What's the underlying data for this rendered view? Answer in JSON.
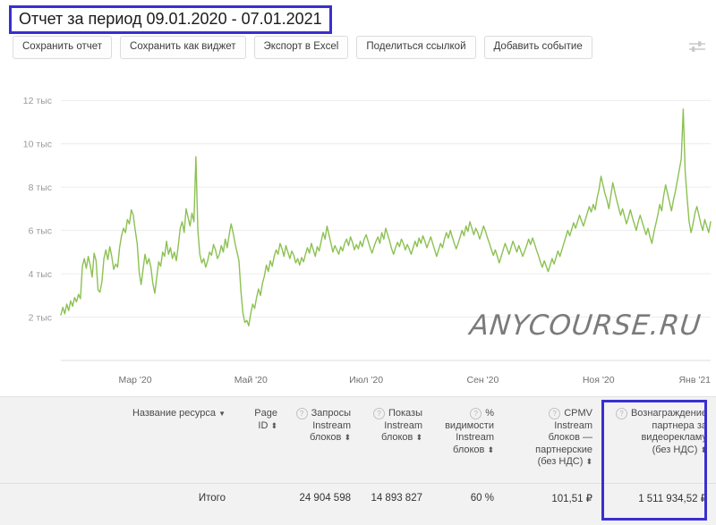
{
  "header": {
    "title": "Отчет за период 09.01.2020 - 07.01.2021",
    "highlight_color": "#3a2fd0"
  },
  "toolbar": {
    "buttons": [
      {
        "label": "Сохранить отчет",
        "name": "save-report-button"
      },
      {
        "label": "Сохранить как виджет",
        "name": "save-as-widget-button"
      },
      {
        "label": "Экспорт в Excel",
        "name": "export-excel-button"
      },
      {
        "label": "Поделиться ссылкой",
        "name": "share-link-button"
      },
      {
        "label": "Добавить событие",
        "name": "add-event-button"
      }
    ],
    "settings_icon": "sliders-icon"
  },
  "watermark": "ANYCOURSE.RU",
  "chart_data": {
    "type": "line",
    "title": "",
    "xlabel": "",
    "ylabel": "",
    "line_color": "#8cc152",
    "grid": true,
    "ylim": [
      0,
      13000
    ],
    "yticks": [
      2000,
      4000,
      6000,
      8000,
      10000,
      12000
    ],
    "ytick_labels": [
      "2 тыс",
      "4 тыс",
      "6 тыс",
      "8 тыс",
      "10 тыс",
      "12 тыс"
    ],
    "xtick_labels": [
      "Мар '20",
      "Май '20",
      "Июл '20",
      "Сен '20",
      "Ноя '20",
      "Янв '21"
    ],
    "xtick_positions": [
      0.14,
      0.318,
      0.496,
      0.674,
      0.852,
      1.0
    ],
    "series": [
      {
        "name": "Вознаграждение партнера за видеорекламу",
        "values": [
          2100,
          2450,
          2150,
          2600,
          2300,
          2750,
          2500,
          2900,
          2700,
          3050,
          2850,
          4350,
          4700,
          4250,
          4800,
          4400,
          3850,
          4950,
          4600,
          3250,
          3150,
          3650,
          4700,
          5100,
          4650,
          5250,
          4800,
          4200,
          4450,
          4300,
          5200,
          5750,
          6100,
          5900,
          6500,
          6300,
          6950,
          6700,
          6000,
          5400,
          4100,
          3500,
          4200,
          4900,
          4450,
          4700,
          4300,
          3550,
          3100,
          3850,
          4550,
          4350,
          5000,
          4800,
          5500,
          4900,
          5200,
          4700,
          5000,
          4600,
          5300,
          6100,
          6400,
          5900,
          7000,
          6600,
          6200,
          6800,
          6400,
          9400,
          6000,
          4900,
          4500,
          4700,
          4300,
          4600,
          5000,
          4850,
          5350,
          5100,
          4700,
          4900,
          5300,
          5000,
          5600,
          5200,
          5800,
          6300,
          5900,
          5400,
          5000,
          4600,
          3200,
          2200,
          1750,
          1850,
          1600,
          2150,
          2600,
          2400,
          2900,
          3300,
          3000,
          3550,
          3900,
          4400,
          4100,
          4600,
          4350,
          4800,
          5100,
          4900,
          5400,
          5150,
          4800,
          5300,
          5000,
          4700,
          5050,
          4850,
          4500,
          4700,
          4400,
          4750,
          4550,
          4900,
          5200,
          4950,
          5400,
          5100,
          4800,
          5250,
          5050,
          5500,
          5900,
          5600,
          6200,
          5800,
          5400,
          5000,
          5300,
          5100,
          4900,
          5250,
          5050,
          5400,
          5600,
          5300,
          5700,
          5450,
          5100,
          5350,
          5150,
          5500,
          5250,
          5600,
          5800,
          5500,
          5200,
          4950,
          5250,
          5500,
          5700,
          5400,
          5900,
          5600,
          6100,
          5800,
          5500,
          5150,
          4900,
          5200,
          5450,
          5250,
          5600,
          5400,
          5100,
          5350,
          5150,
          4900,
          5200,
          5500,
          5250,
          5650,
          5400,
          5750,
          5500,
          5200,
          5450,
          5700,
          5400,
          5100,
          4800,
          5100,
          5400,
          5200,
          5600,
          5900,
          5650,
          6000,
          5700,
          5400,
          5150,
          5400,
          5700,
          6000,
          5750,
          6200,
          5950,
          6400,
          6100,
          5800,
          6100,
          5900,
          5600,
          5900,
          6200,
          5950,
          5650,
          5400,
          5100,
          4850,
          5100,
          4800,
          4500,
          4800,
          5100,
          5400,
          5150,
          4900,
          5200,
          5500,
          5250,
          5000,
          5300,
          5050,
          4800,
          5050,
          5300,
          5600,
          5350,
          5650,
          5400,
          5100,
          4850,
          4550,
          4300,
          4600,
          4350,
          4100,
          4400,
          4700,
          4450,
          4750,
          5050,
          4800,
          5100,
          5400,
          5700,
          6000,
          5750,
          6050,
          6350,
          6100,
          6400,
          6700,
          6450,
          6200,
          6500,
          6800,
          7100,
          6850,
          7200,
          6950,
          7500,
          7900,
          8500,
          8100,
          7700,
          7400,
          7000,
          7600,
          8200,
          7800,
          7400,
          7050,
          6700,
          7000,
          6650,
          6300,
          6600,
          6950,
          6600,
          6300,
          6000,
          6400,
          6700,
          6400,
          6100,
          5800,
          6100,
          5700,
          5400,
          5900,
          6300,
          6700,
          7200,
          6900,
          7600,
          8100,
          7700,
          7300,
          6900,
          7400,
          7800,
          8300,
          8800,
          9300,
          11600,
          8700,
          7500,
          6400,
          5900,
          6300,
          6800,
          7100,
          6700,
          6300,
          6000,
          6500,
          6200,
          5900,
          6400
        ]
      }
    ]
  },
  "table": {
    "columns": [
      {
        "name": "resource-name",
        "lines": [
          "Название ресурса"
        ],
        "sort": "caret",
        "help": false
      },
      {
        "name": "page-id",
        "lines": [
          "Page",
          "ID"
        ],
        "sort": "updown",
        "help": false
      },
      {
        "name": "instream-requests",
        "lines": [
          "Запросы",
          "Instream",
          "блоков"
        ],
        "sort": "updown",
        "help": true
      },
      {
        "name": "instream-impressions",
        "lines": [
          "Показы",
          "Instream",
          "блоков"
        ],
        "sort": "updown",
        "help": true
      },
      {
        "name": "instream-visibility-percent",
        "lines": [
          "%",
          "видимости",
          "Instream",
          "блоков"
        ],
        "sort": "updown",
        "help": true
      },
      {
        "name": "cpmv-instream-partner",
        "lines": [
          "CPMV",
          "Instream",
          "блоков —",
          "партнерские",
          "(без НДС)"
        ],
        "sort": "updown",
        "help": true
      },
      {
        "name": "partner-video-reward",
        "lines": [
          "Вознаграждение",
          "партнера за",
          "видеорекламу",
          "(без НДС)"
        ],
        "sort": "updown",
        "help": true,
        "highlighted": true
      }
    ],
    "total_row": {
      "label": "Итого",
      "values": [
        "",
        "",
        "24 904 598",
        "14 893 827",
        "60 %",
        "101,51 ₽",
        "1 511 934,52 ₽"
      ]
    }
  }
}
